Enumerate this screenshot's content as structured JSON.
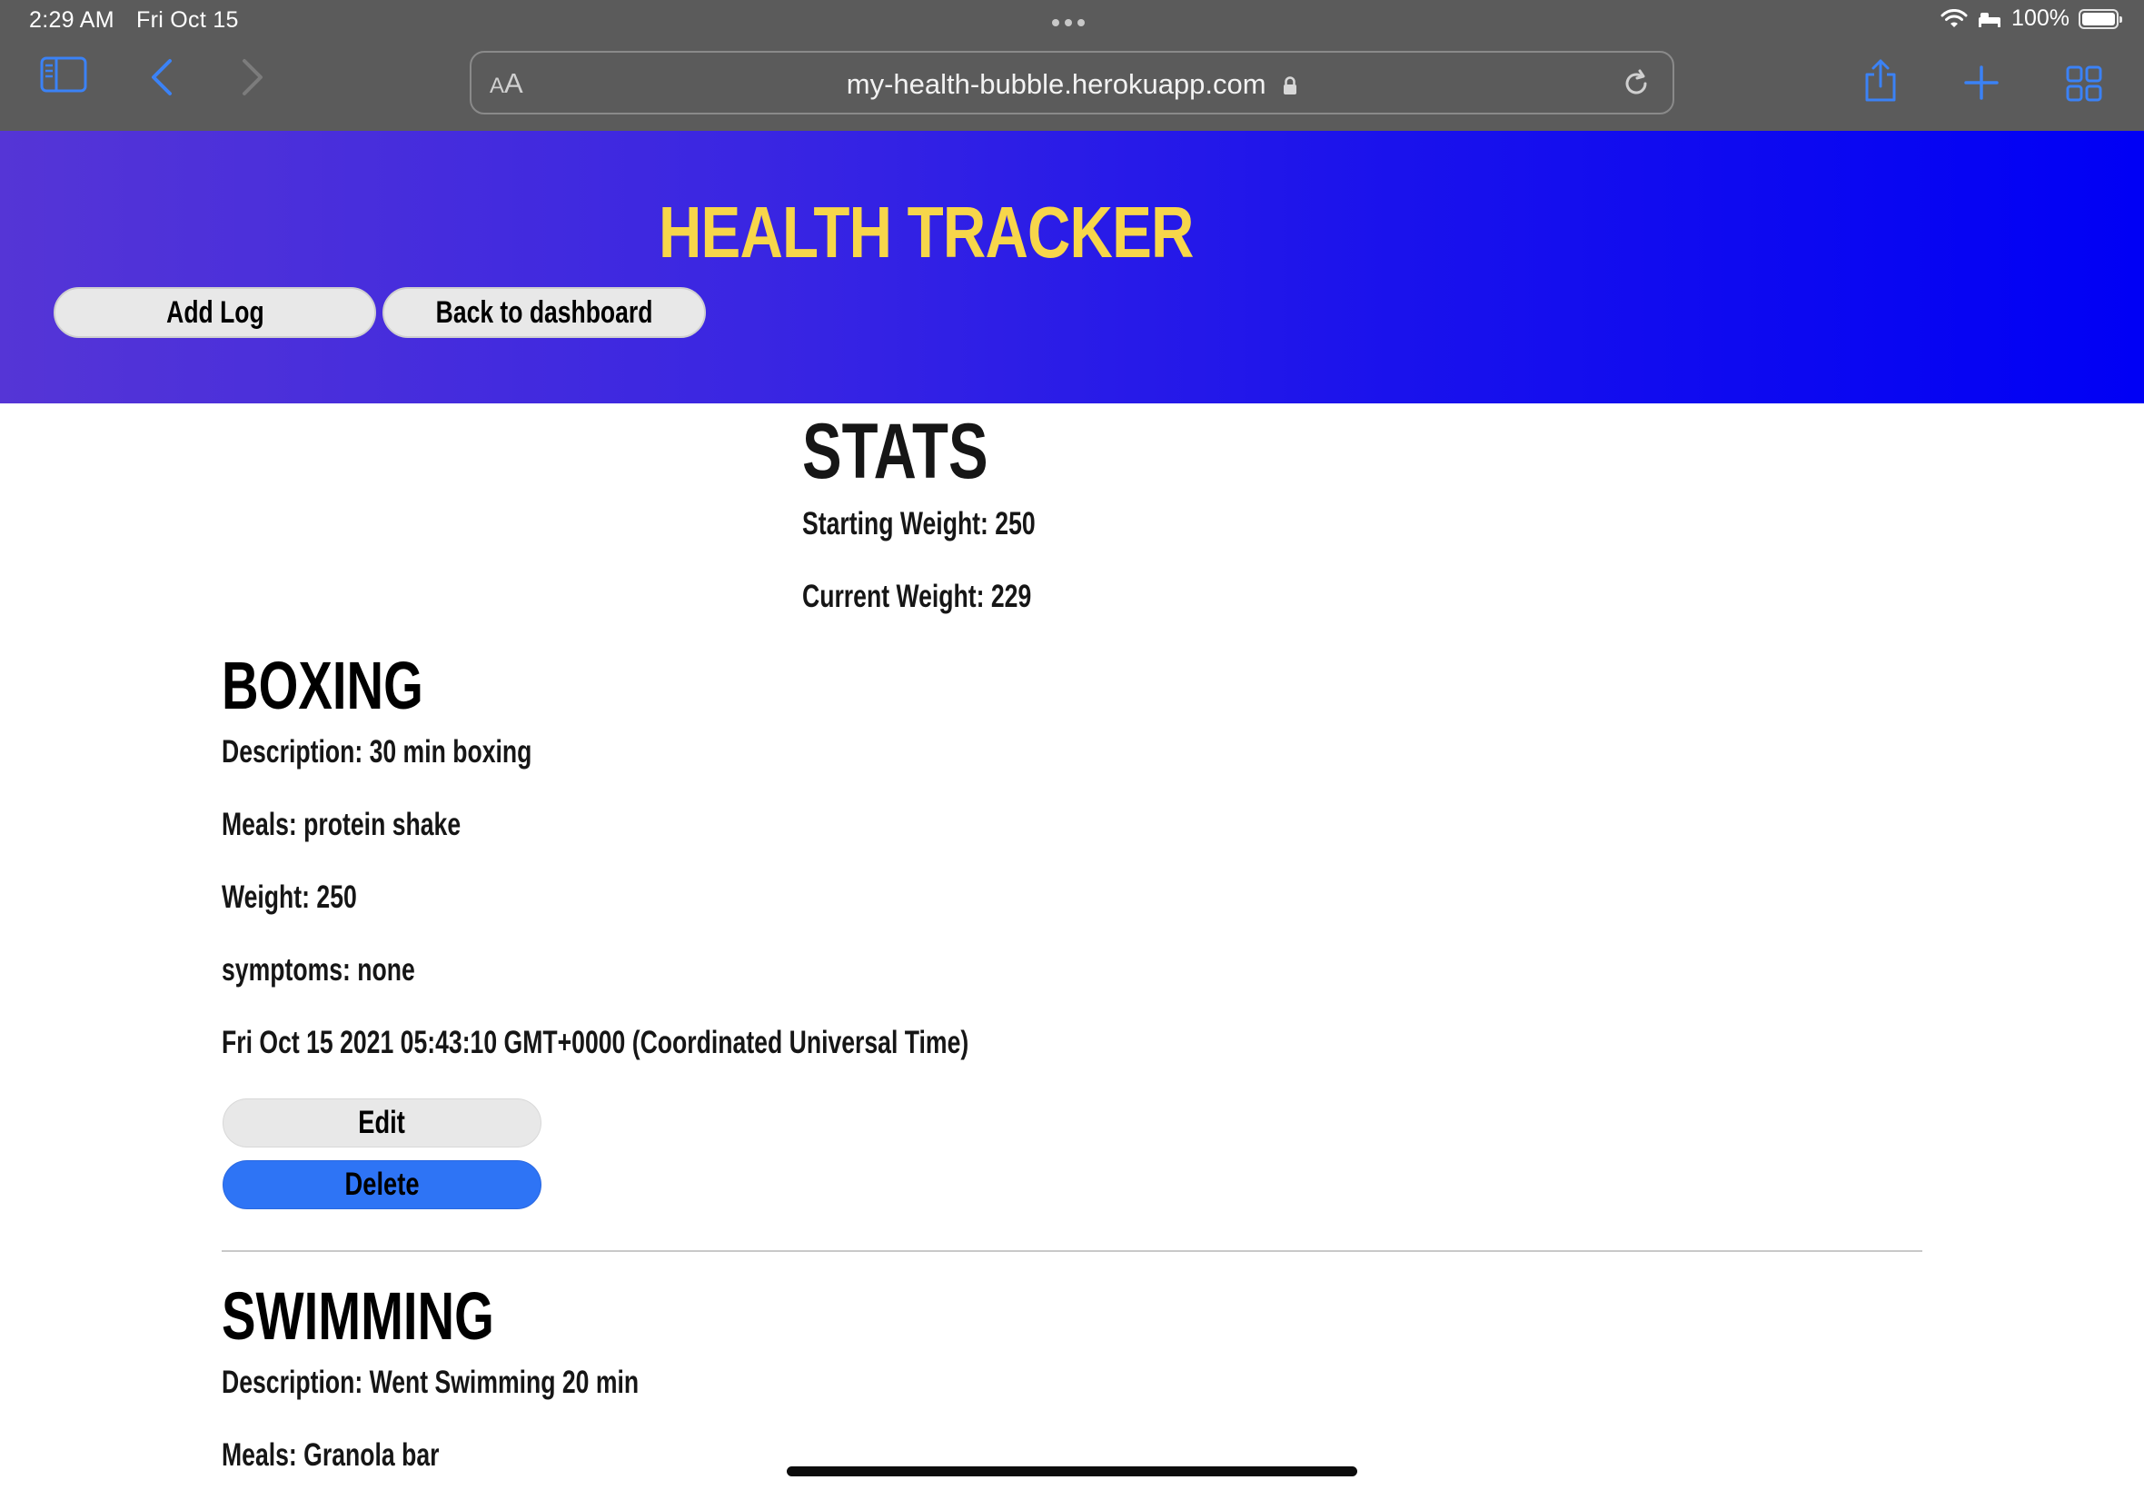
{
  "status_bar": {
    "time": "2:29 AM",
    "date": "Fri Oct 15",
    "battery": "100%"
  },
  "browser": {
    "aa_small": "A",
    "aa_large": "A",
    "url": "my-health-bubble.herokuapp.com",
    "icons": [
      "sidebar-icon",
      "back-arrow-icon",
      "forward-arrow-icon",
      "lock-icon",
      "reload-icon",
      "share-icon",
      "new-tab-icon",
      "tabs-overview-icon",
      "wifi-icon",
      "bed-icon",
      "battery-icon"
    ]
  },
  "header": {
    "title": "HEALTH TRACKER",
    "add_log": "Add Log",
    "back_to_dashboard": "Back to dashboard",
    "gradient_start": "#5535d6",
    "gradient_end": "#0000f5",
    "title_color": "#f7d64a"
  },
  "stats": {
    "title": "STATS",
    "starting_weight": "Starting Weight: 250",
    "current_weight": "Current Weight: 229"
  },
  "logs": [
    {
      "title": "BOXING",
      "description": "Description: 30 min boxing",
      "meals": "Meals: protein shake",
      "weight": "Weight: 250",
      "symptoms": "symptoms: none",
      "timestamp": "Fri Oct 15 2021 05:43:10 GMT+0000 (Coordinated Universal Time)",
      "edit_label": "Edit",
      "delete_label": "Delete"
    },
    {
      "title": "SWIMMING",
      "description": "Description: Went Swimming 20 min",
      "meals": "Meals: Granola bar"
    }
  ],
  "colors": {
    "delete_button": "#2e74f5",
    "edit_button": "#e8e8e8",
    "browser_chrome": "#5b5b5b"
  }
}
